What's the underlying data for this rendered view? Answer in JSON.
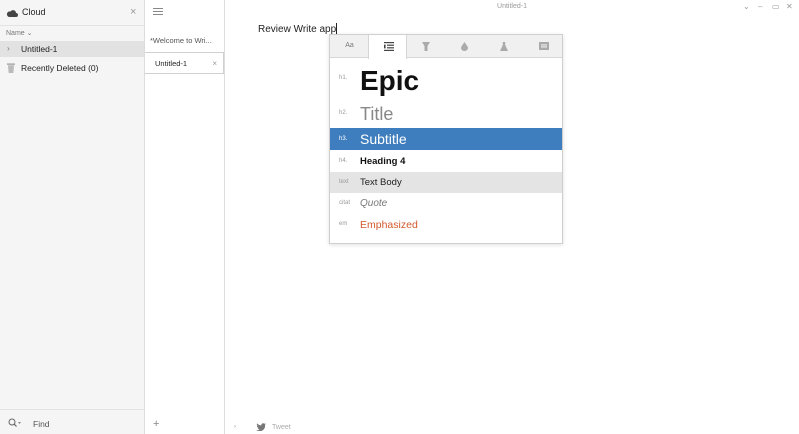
{
  "sidebar": {
    "title": "Cloud",
    "close_icon": "×",
    "column_header": "Name ⌄",
    "items": [
      {
        "label": "Untitled-1",
        "chevron": "›"
      },
      {
        "label": "Recently Deleted (0)"
      }
    ],
    "find_placeholder": "Find"
  },
  "doclist": {
    "items": [
      {
        "label": "*Welcome to Wri..."
      },
      {
        "label": "Untitled-1",
        "close": "×"
      }
    ],
    "add_icon": "+"
  },
  "window": {
    "title": "Untitled-1",
    "controls": [
      "⌄",
      "–",
      "▭",
      "✕"
    ]
  },
  "editor": {
    "text": "Review Write app",
    "footer_arrow": "›",
    "tweet": "Tweet"
  },
  "popup": {
    "tabs": [
      {
        "label": "Aa",
        "icon": "font-icon"
      },
      {
        "label": "",
        "icon": "paragraph-styles-icon"
      },
      {
        "label": "",
        "icon": "highlighter-icon"
      },
      {
        "label": "",
        "icon": "ink-drop-icon"
      },
      {
        "label": "",
        "icon": "flask-icon"
      },
      {
        "label": "",
        "icon": "card-icon"
      }
    ],
    "styles": [
      {
        "tag": "h1.",
        "name": "Epic"
      },
      {
        "tag": "h2.",
        "name": "Title"
      },
      {
        "tag": "h3.",
        "name": "Subtitle"
      },
      {
        "tag": "h4.",
        "name": "Heading 4"
      },
      {
        "tag": "text",
        "name": "Text Body"
      },
      {
        "tag": "citat",
        "name": "Quote"
      },
      {
        "tag": "em",
        "name": "Emphasized"
      }
    ],
    "selected_style": "Subtitle"
  },
  "colors": {
    "selection": "#3f7ebe",
    "emphasized": "#d35a2c",
    "sidebar_bg": "#f5f5f5"
  }
}
